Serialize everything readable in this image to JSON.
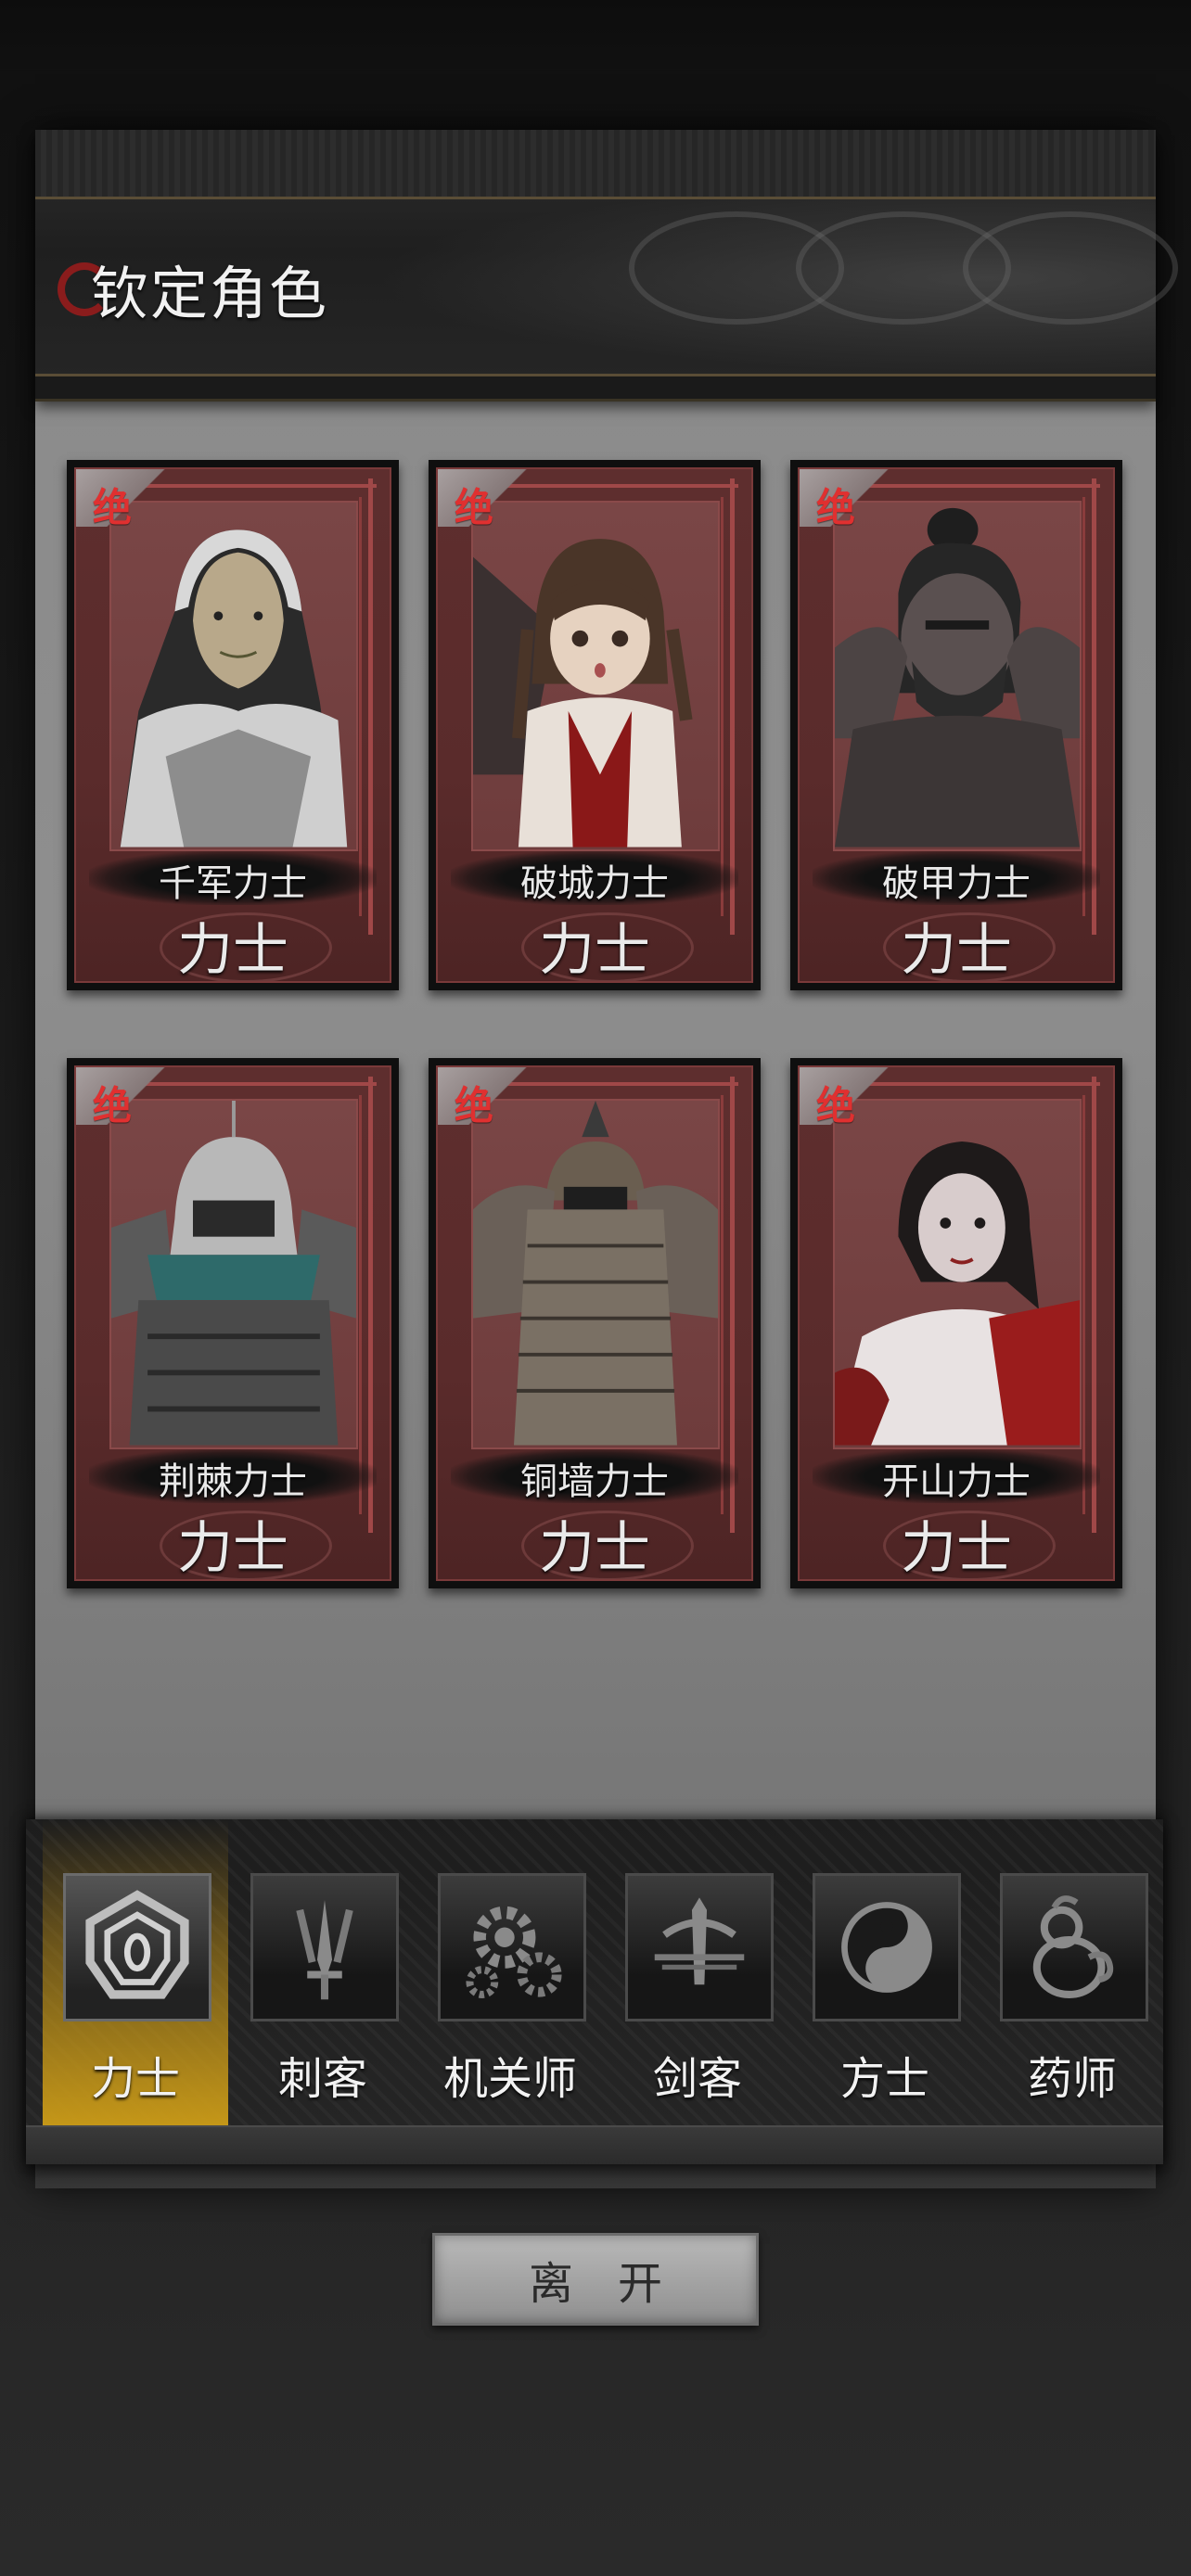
{
  "header": {
    "title": "钦定角色"
  },
  "cards": [
    {
      "rarity": "绝",
      "name": "千军力士",
      "class": "力士",
      "portrait": "hooded-warrior-portrait"
    },
    {
      "rarity": "绝",
      "name": "破城力士",
      "class": "力士",
      "portrait": "young-girl-portrait"
    },
    {
      "rarity": "绝",
      "name": "破甲力士",
      "class": "力士",
      "portrait": "bearded-strongman-portrait"
    },
    {
      "rarity": "绝",
      "name": "荆棘力士",
      "class": "力士",
      "portrait": "armored-knight-portrait"
    },
    {
      "rarity": "绝",
      "name": "铜墙力士",
      "class": "力士",
      "portrait": "scale-armor-giant-portrait"
    },
    {
      "rarity": "绝",
      "name": "开山力士",
      "class": "力士",
      "portrait": "woman-warrior-portrait"
    }
  ],
  "tabs": [
    {
      "label": "力士",
      "icon": "shield-eye-icon",
      "active": true
    },
    {
      "label": "刺客",
      "icon": "claw-blade-icon",
      "active": false
    },
    {
      "label": "机关师",
      "icon": "gears-icon",
      "active": false
    },
    {
      "label": "剑客",
      "icon": "sword-icon",
      "active": false
    },
    {
      "label": "方士",
      "icon": "yin-yang-icon",
      "active": false
    },
    {
      "label": "药师",
      "icon": "gourd-icon",
      "active": false
    }
  ],
  "footer": {
    "leave_label": "离开"
  },
  "colors": {
    "accent_gold": "#c99a18",
    "rarity_red": "#e03030",
    "card_red": "#5e2e2e"
  }
}
